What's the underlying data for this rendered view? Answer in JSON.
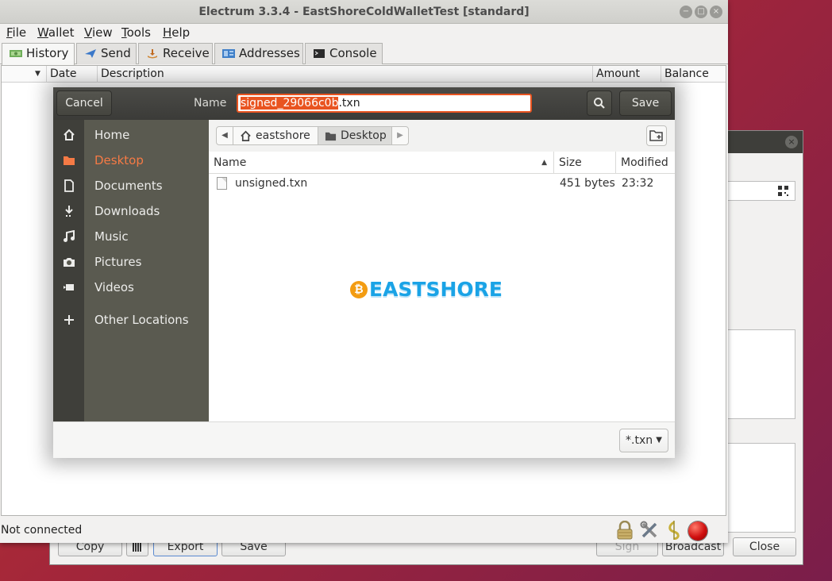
{
  "window": {
    "title": "Electrum 3.3.4  -  EastShoreColdWalletTest  [standard]",
    "minimize_glyph": "−",
    "maximize_glyph": "□",
    "close_glyph": "×"
  },
  "menu": [
    "File",
    "Wallet",
    "View",
    "Tools",
    "Help"
  ],
  "tabs": [
    {
      "label": "History",
      "active": true
    },
    {
      "label": "Send"
    },
    {
      "label": "Receive"
    },
    {
      "label": "Addresses"
    },
    {
      "label": "Console"
    }
  ],
  "history": {
    "columns": [
      "Date",
      "Description",
      "Amount",
      "Balance"
    ],
    "sort_glyph": "▼"
  },
  "status": {
    "text": "Not connected",
    "indicator_color": "#d01010"
  },
  "tx_dialog": {
    "close_glyph": "×",
    "buttons": {
      "copy": "Copy",
      "export": "Export",
      "save": "Save",
      "sign": "Sign",
      "broadcast": "Broadcast",
      "close": "Close"
    }
  },
  "file_dialog": {
    "cancel_label": "Cancel",
    "name_label": "Name",
    "filename_selected": "signed_29066c0b",
    "filename_extension": ".txn",
    "save_label": "Save",
    "accent_color": "#e95420",
    "places": [
      {
        "label": "Home",
        "icon": "home-icon"
      },
      {
        "label": "Desktop",
        "icon": "folder-icon",
        "active": true
      },
      {
        "label": "Documents",
        "icon": "document-icon"
      },
      {
        "label": "Downloads",
        "icon": "download-icon"
      },
      {
        "label": "Music",
        "icon": "music-icon"
      },
      {
        "label": "Pictures",
        "icon": "camera-icon"
      },
      {
        "label": "Videos",
        "icon": "video-icon"
      },
      {
        "label": "Other Locations",
        "icon": "plus-icon"
      }
    ],
    "path": {
      "back_glyph": "◀",
      "forward_glyph": "▶",
      "home": "eastshore",
      "current": "Desktop"
    },
    "columns": {
      "name": "Name",
      "size": "Size",
      "modified": "Modified",
      "sort_glyph": "▲"
    },
    "files": [
      {
        "name": "unsigned.txn",
        "size": "451 bytes",
        "modified": "23:32"
      }
    ],
    "watermark": {
      "coin_glyph": "₿",
      "text": "EASTSHORE"
    },
    "filter": {
      "value": "*.txn",
      "caret_glyph": "▼"
    }
  }
}
